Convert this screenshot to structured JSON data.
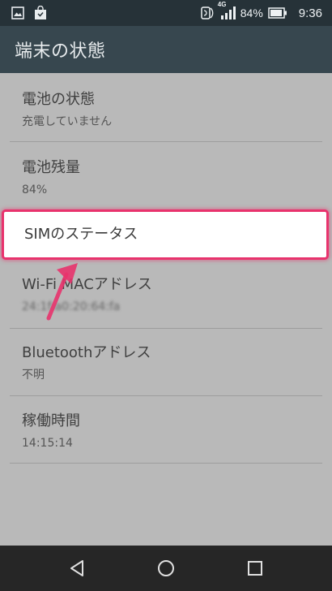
{
  "status_bar": {
    "network": "4G",
    "battery_percent": "84%",
    "time": "9:36",
    "left_icons": [
      "image-notification-icon",
      "shopping-bag-notification-icon"
    ],
    "right_icons": [
      "nfc-icon",
      "signal-icon",
      "battery-icon"
    ]
  },
  "toolbar": {
    "title": "端末の状態"
  },
  "list": {
    "items": [
      {
        "title": "電池の状態",
        "subtitle": "充電していません"
      },
      {
        "title": "電池残量",
        "subtitle": "84%"
      },
      {
        "title": "SIMのステータス",
        "subtitle": ""
      },
      {
        "title": "Wi-Fi MACアドレス",
        "subtitle": "24:1f:a0:20:64:fa"
      },
      {
        "title": "Bluetoothアドレス",
        "subtitle": "不明"
      },
      {
        "title": "稼働時間",
        "subtitle": "14:15:14"
      }
    ]
  },
  "annotation": {
    "highlight_color": "#e8336d"
  },
  "nav_bar": {
    "buttons": [
      "back",
      "home",
      "recents"
    ]
  }
}
